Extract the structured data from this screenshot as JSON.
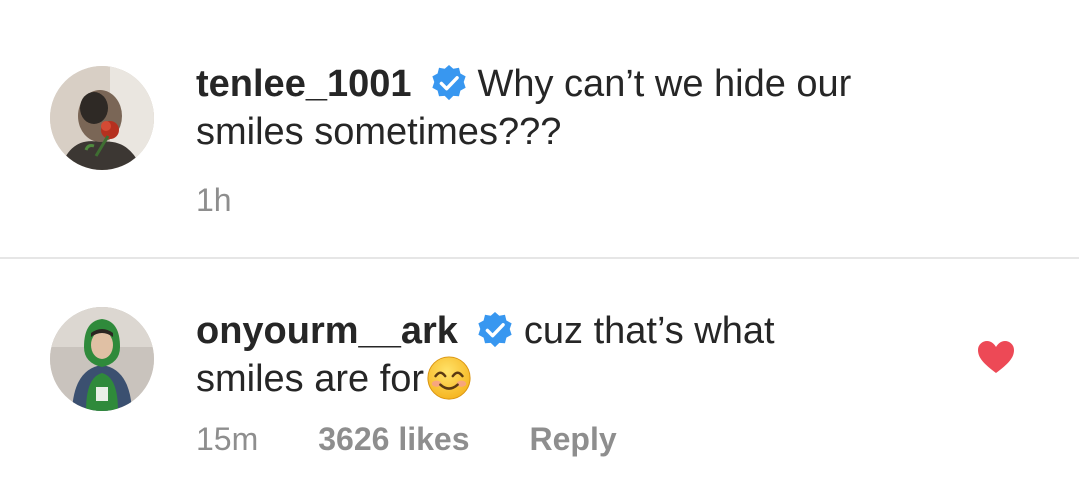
{
  "comments": [
    {
      "username": "tenlee_1001",
      "verified": true,
      "text_line1": "Why can’t we hide our",
      "text_line2": "smiles sometimes???",
      "time": "1h"
    },
    {
      "username": "onyourm__ark",
      "verified": true,
      "text_line1": "cuz that’s what",
      "text_line2": "smiles are for",
      "emoji": "smiling-face-with-smiling-eyes-emoji",
      "time": "15m",
      "likes": "3626 likes",
      "reply_label": "Reply",
      "liked": true
    }
  ],
  "colors": {
    "text": "#262626",
    "secondary_text": "#8e8e8e",
    "verified_blue": "#3897f0",
    "liked_heart": "#ed4956",
    "divider": "#e6e6e6"
  },
  "icons": {
    "verified": "verified-badge-icon",
    "like": "heart-icon"
  }
}
